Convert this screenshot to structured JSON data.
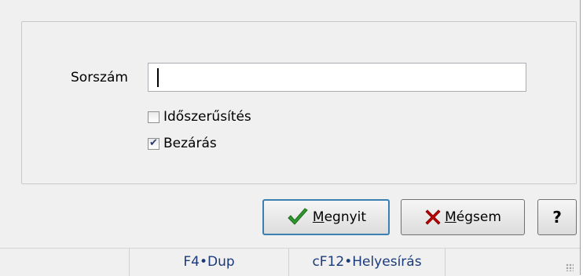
{
  "form": {
    "sorszam_label": "Sorszám",
    "sorszam_value": "",
    "checkboxes": [
      {
        "label": "Időszerűsítés",
        "checked": false
      },
      {
        "label": "Bezárás",
        "checked": true
      }
    ]
  },
  "buttons": {
    "open_label": "Megnyit",
    "cancel_label": "Mégsem",
    "help_label": "?"
  },
  "statusbar": {
    "cells": [
      "",
      "F4•Dup",
      "cF12•Helyesírás",
      ""
    ]
  },
  "colors": {
    "dialog_bg": "#f0f0f0",
    "default_button_border": "#3c7fb1",
    "check_icon": "#2e9a2e",
    "cancel_icon": "#c00000",
    "status_text": "#1b3a7a"
  },
  "icons": {
    "open": "checkmark-icon",
    "cancel": "x-icon"
  }
}
